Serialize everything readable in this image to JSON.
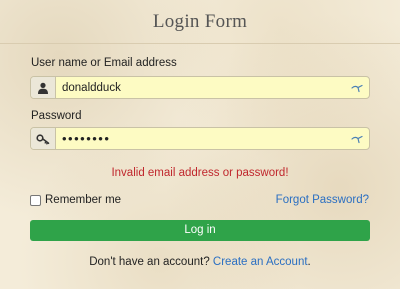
{
  "form": {
    "title": "Login Form",
    "username": {
      "label": "User name or Email address",
      "value": "donaldduck",
      "icon": "user-icon"
    },
    "password": {
      "label": "Password",
      "masked_value": "••••••••",
      "icon": "key-icon"
    },
    "error": "Invalid email address or password!",
    "remember_label": "Remember me",
    "remember_checked": false,
    "forgot_label": "Forgot Password?",
    "login_label": "Log in",
    "signup_prompt": "Don't have an account?",
    "signup_link": "Create an Account",
    "signup_suffix": "."
  },
  "colors": {
    "background": "#f4ecd9",
    "input_fill": "#fdfbc3",
    "login_button": "#2fa349",
    "error_text": "#c0272d",
    "link": "#2a6fc2"
  }
}
